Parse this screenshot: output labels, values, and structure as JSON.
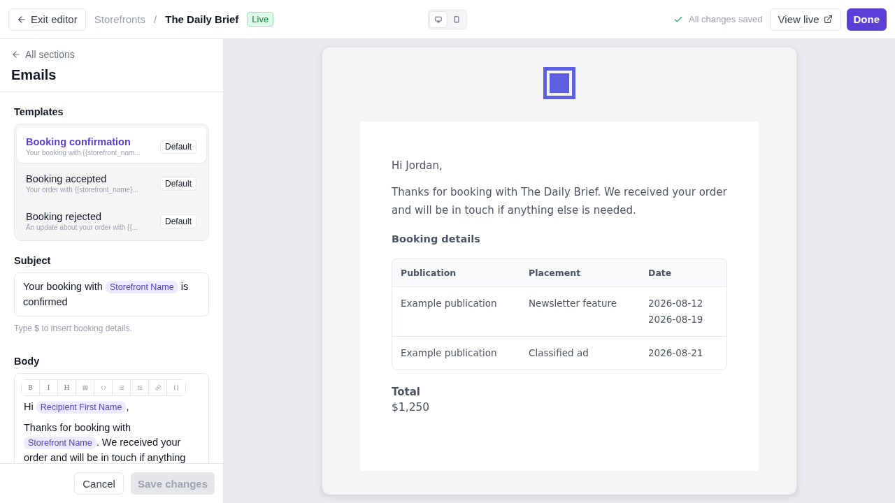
{
  "header": {
    "exit": "Exit editor",
    "breadcrumb": "Storefronts",
    "separator": "/",
    "title": "The Daily Brief",
    "status": "Live",
    "devices": [
      {
        "kind": "desktop",
        "selected": true
      },
      {
        "kind": "mobile",
        "selected": false
      }
    ],
    "saved": "All changes saved",
    "view_live": "View live",
    "done": "Done"
  },
  "sidebar": {
    "back": "All sections",
    "title": "Emails",
    "templates_label": "Templates",
    "templates": [
      {
        "name": "Booking confirmation",
        "preview": "Your booking with {{storefront_nam...",
        "badge": "Default",
        "selected": true
      },
      {
        "name": "Booking accepted",
        "preview": "Your order with {{storefront_name}...",
        "badge": "Default",
        "selected": false
      },
      {
        "name": "Booking rejected",
        "preview": "An update about your order with {{...",
        "badge": "Default",
        "selected": false
      }
    ],
    "subject_label": "Subject",
    "subject": [
      {
        "kind": "text",
        "text": "Your booking with "
      },
      {
        "kind": "token",
        "text": "Storefront Name"
      },
      {
        "kind": "text",
        "text": " is confirmed"
      }
    ],
    "subject_hint": "Type **$** to insert booking details.",
    "body_label": "Body",
    "toolbar": [
      {
        "kind": "text",
        "label": "B"
      },
      {
        "kind": "text",
        "label": "I"
      },
      {
        "kind": "text",
        "label": "H"
      },
      {
        "kind": "quote"
      },
      {
        "kind": "code"
      },
      {
        "kind": "bullets"
      },
      {
        "kind": "numbers"
      },
      {
        "kind": "link"
      },
      {
        "kind": "braces"
      }
    ],
    "body": [
      [
        {
          "kind": "text",
          "text": "Hi "
        },
        {
          "kind": "token",
          "text": "Recipient First Name"
        },
        {
          "kind": "text",
          "text": ","
        }
      ],
      [
        {
          "kind": "text",
          "text": "Thanks for booking with "
        },
        {
          "kind": "token",
          "text": "Storefront Name"
        },
        {
          "kind": "text",
          "text": ". We received your order and will be in touch if anything"
        }
      ]
    ],
    "cancel": "Cancel",
    "save": {
      "label": "Save changes",
      "disabled": true
    }
  },
  "preview": {
    "greeting": "Hi Jordan,",
    "intro": "Thanks for booking with The Daily Brief. We received your order and will be in touch if anything else is needed.",
    "details_title": "Booking details",
    "columns": [
      "Publication",
      "Placement",
      "Date"
    ],
    "rows": [
      {
        "publication": "Example publication",
        "placement": "Newsletter feature",
        "dates": [
          "2026-08-12",
          "2026-08-19"
        ]
      },
      {
        "publication": "Example publication",
        "placement": "Classified ad",
        "dates": [
          "2026-08-21"
        ]
      }
    ],
    "total_label": "Total",
    "total": "$1,250"
  }
}
